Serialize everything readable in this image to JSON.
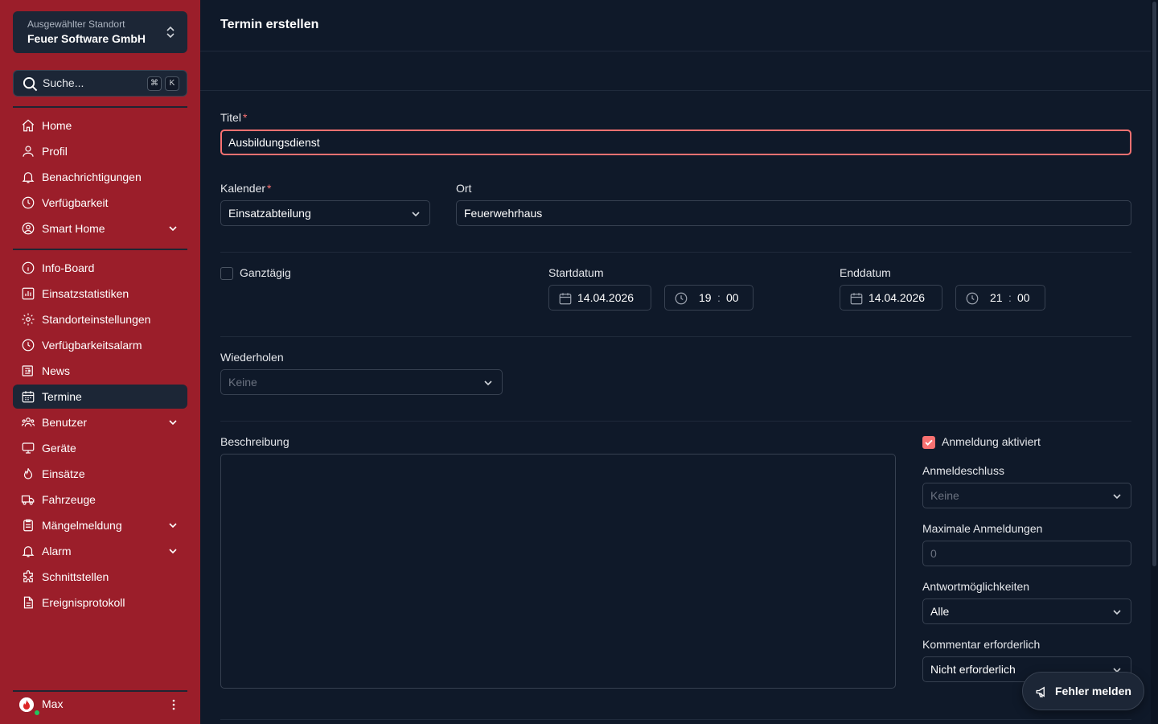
{
  "location": {
    "label": "Ausgewählter Standort",
    "name": "Feuer Software GmbH"
  },
  "search": {
    "placeholder": "Suche...",
    "kbd1": "⌘",
    "kbd2": "K"
  },
  "nav": {
    "home": "Home",
    "profil": "Profil",
    "benachrichtigungen": "Benachrichtigungen",
    "verfuegbarkeit": "Verfügbarkeit",
    "smarthome": "Smart Home",
    "infoboard": "Info-Board",
    "einsatzstatistiken": "Einsatzstatistiken",
    "standorteinstellungen": "Standorteinstellungen",
    "verfuegbarkeitsalarm": "Verfügbarkeitsalarm",
    "news": "News",
    "termine": "Termine",
    "benutzer": "Benutzer",
    "geraete": "Geräte",
    "einsaetze": "Einsätze",
    "fahrzeuge": "Fahrzeuge",
    "maengelmeldung": "Mängelmeldung",
    "alarm": "Alarm",
    "schnittstellen": "Schnittstellen",
    "ereignisprotokoll": "Ereignisprotokoll"
  },
  "user": {
    "name": "Max"
  },
  "page": {
    "title": "Termin erstellen"
  },
  "form": {
    "titel_label": "Titel",
    "titel_value": "Ausbildungsdienst",
    "kalender_label": "Kalender",
    "kalender_value": "Einsatzabteilung",
    "ort_label": "Ort",
    "ort_value": "Feuerwehrhaus",
    "ganztaegig_label": "Ganztägig",
    "start_label": "Startdatum",
    "start_date": "14.04.2026",
    "start_hour": "19",
    "start_min": "00",
    "end_label": "Enddatum",
    "end_date": "14.04.2026",
    "end_hour": "21",
    "end_min": "00",
    "wiederholen_label": "Wiederholen",
    "wiederholen_value": "Keine",
    "beschreibung_label": "Beschreibung",
    "anmeldung_label": "Anmeldung aktiviert",
    "anmeldeschluss_label": "Anmeldeschluss",
    "anmeldeschluss_value": "Keine",
    "max_anmeldungen_label": "Maximale Anmeldungen",
    "max_anmeldungen_placeholder": "0",
    "antwort_label": "Antwortmöglichkeiten",
    "antwort_value": "Alle",
    "kommentar_label": "Kommentar erforderlich",
    "kommentar_value": "Nicht erforderlich",
    "required_mark": "*",
    "time_sep": ":"
  },
  "fab": {
    "label": "Fehler melden"
  },
  "colors": {
    "sidebar": "#9b1e2a",
    "background": "#0f1929",
    "accent": "#f87171"
  }
}
